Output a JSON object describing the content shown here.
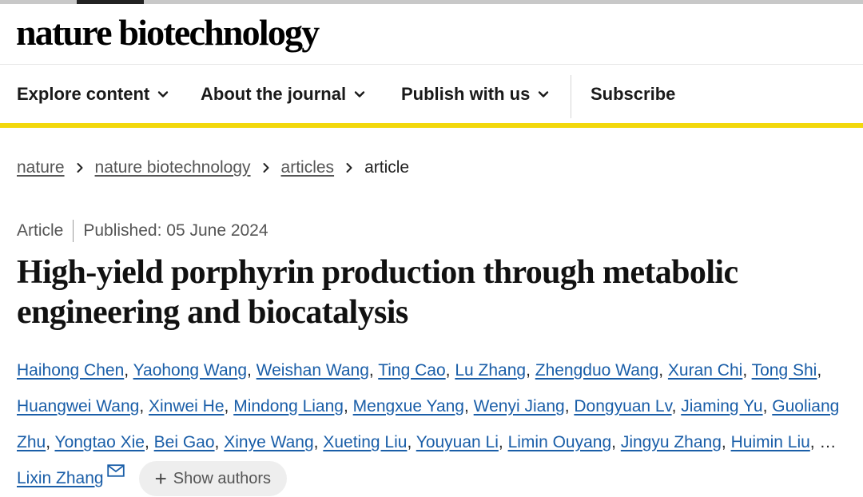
{
  "header": {
    "logo": "nature biotechnology"
  },
  "nav": {
    "explore": "Explore content",
    "about": "About the journal",
    "publish": "Publish with us",
    "subscribe": "Subscribe",
    "icons": [
      "chevron-down-icon",
      "chevron-down-icon",
      "chevron-down-icon"
    ]
  },
  "breadcrumb": {
    "items": [
      "nature",
      "nature biotechnology",
      "articles"
    ],
    "current": "article"
  },
  "meta": {
    "type": "Article",
    "published": "Published: 05 June 2024"
  },
  "article": {
    "title": "High-yield porphyrin production through metabolic engineering and biocatalysis"
  },
  "authors": {
    "list": [
      "Haihong Chen",
      "Yaohong Wang",
      "Weishan Wang",
      "Ting Cao",
      "Lu Zhang",
      "Zhengduo Wang",
      "Xuran Chi",
      "Tong Shi",
      "Huangwei Wang",
      "Xinwei He",
      "Mindong Liang",
      "Mengxue Yang",
      "Wenyi Jiang",
      "Dongyuan Lv",
      "Jiaming Yu",
      "Guoliang Zhu",
      "Yongtao Xie",
      "Bei Gao",
      "Xinye Wang",
      "Xueting Liu",
      "Youyuan Li",
      "Limin Ouyang",
      "Jingyu Zhang",
      "Huimin Liu"
    ],
    "ellipsis": "…",
    "corresponding": "Lixin Zhang",
    "show_button": "Show authors"
  },
  "colors": {
    "accent_yellow": "#f2d80c",
    "link_blue": "#1a5ea8"
  }
}
